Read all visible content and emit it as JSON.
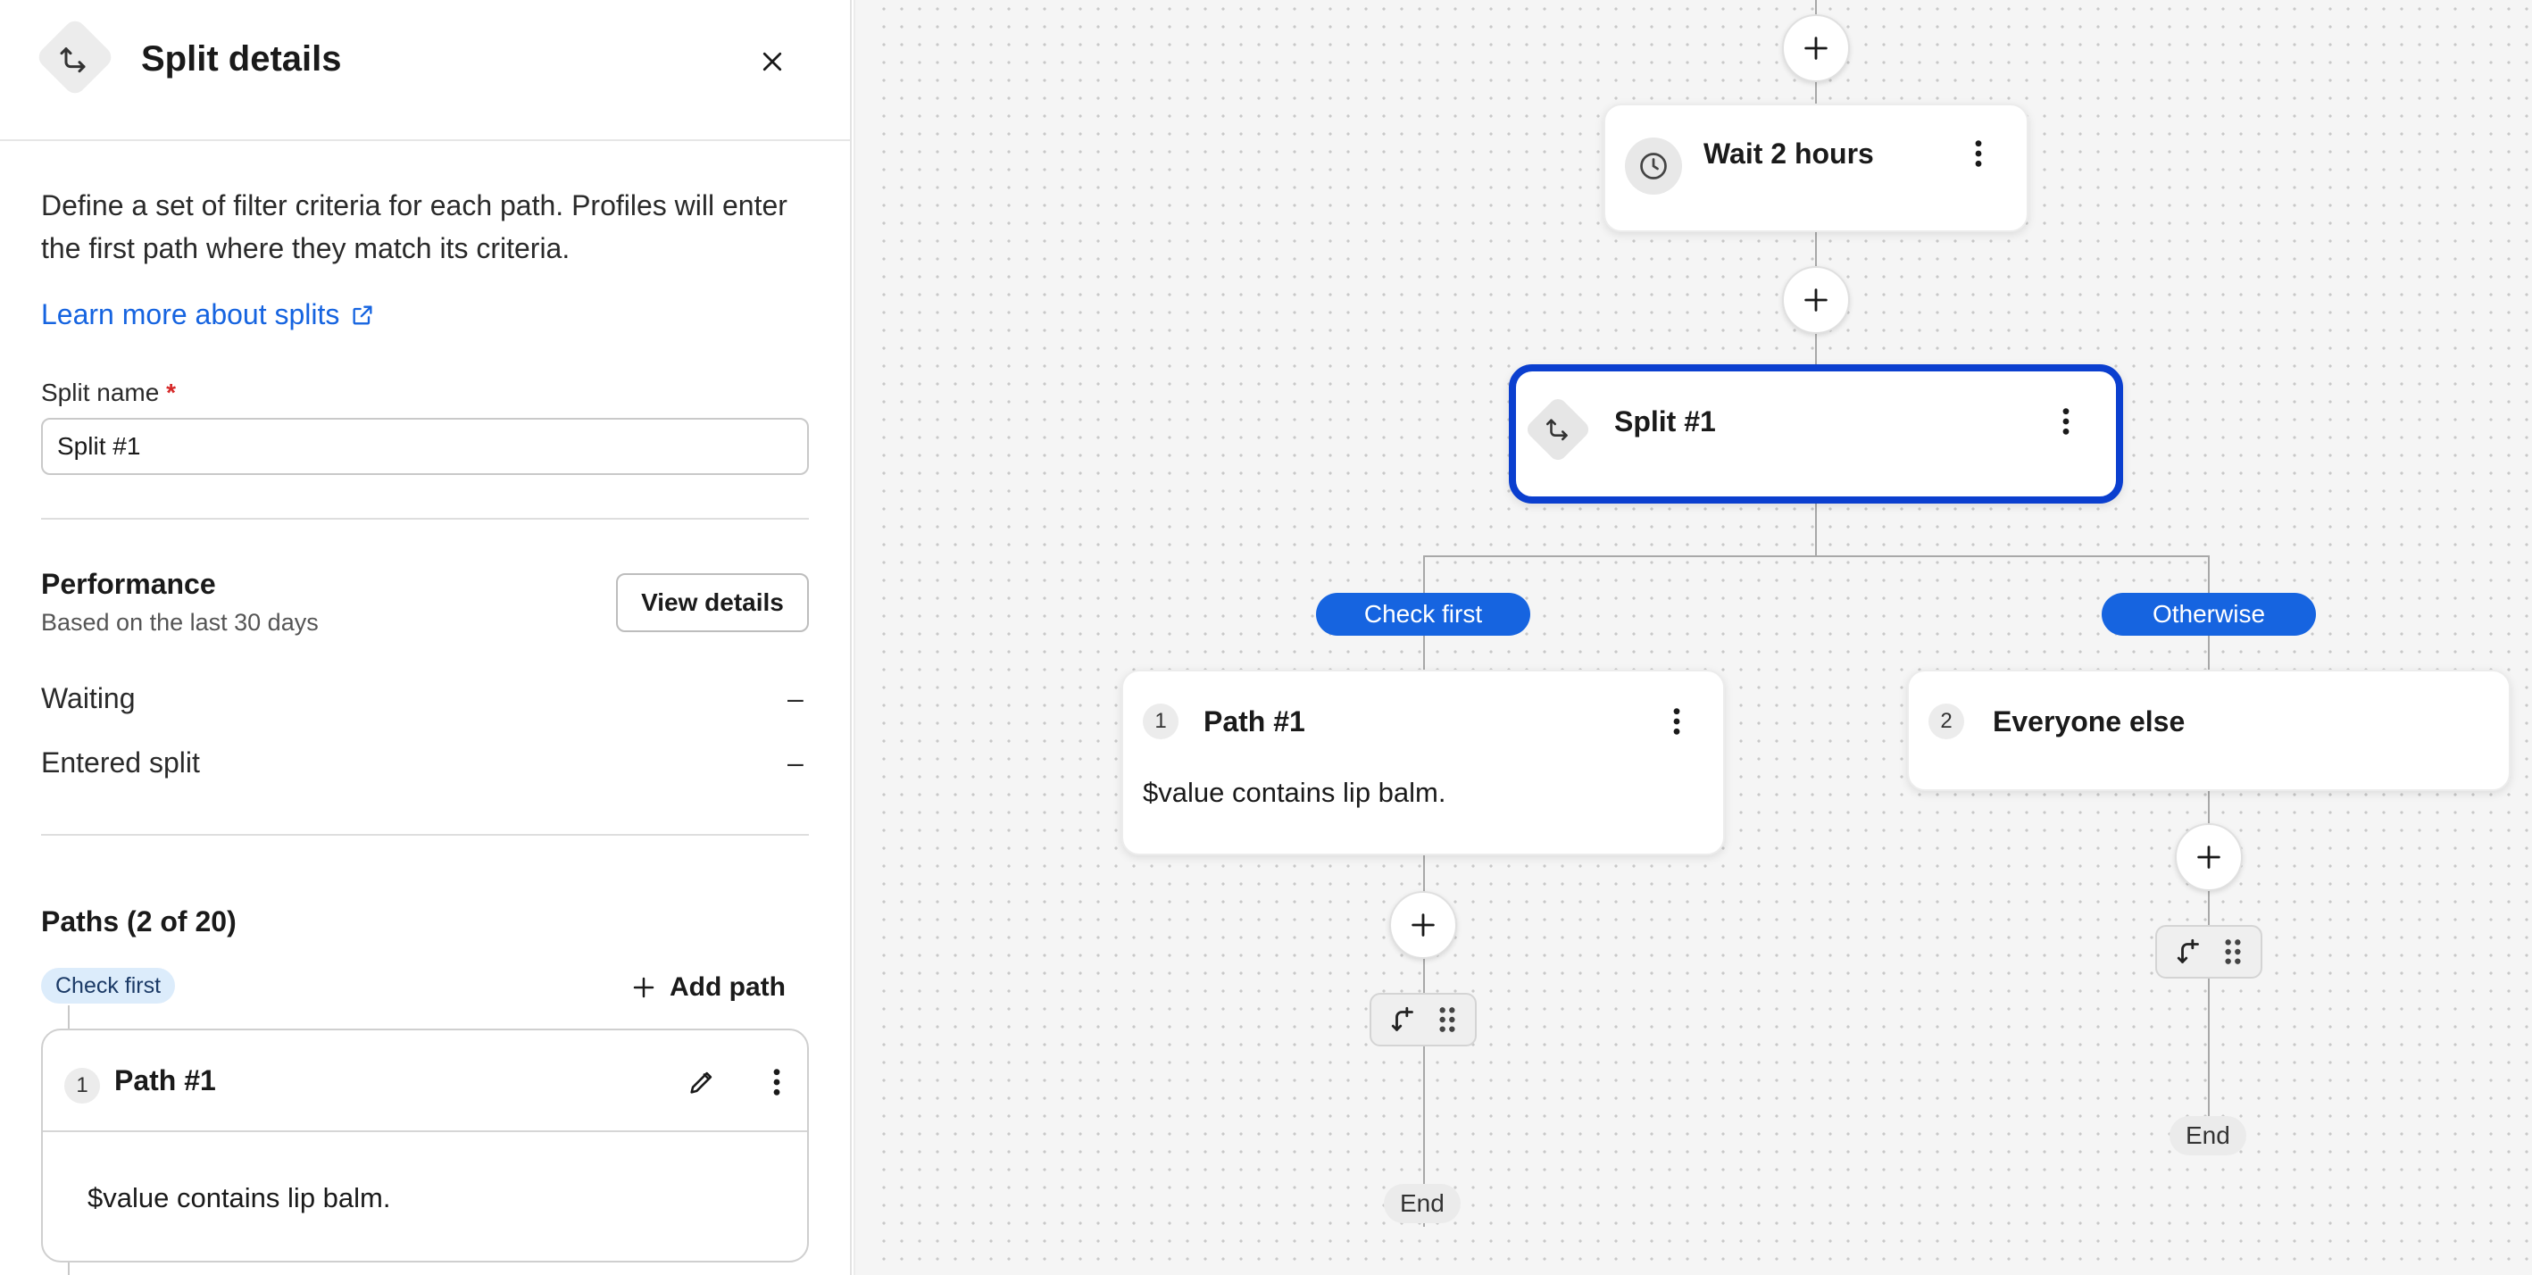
{
  "panel": {
    "title": "Split details",
    "description": "Define a set of filter criteria for each path. Profiles will enter the first path where they match its criteria.",
    "learn_more": "Learn more about splits",
    "split_name_label": "Split name",
    "required_mark": "*",
    "split_name_value": "Split #1",
    "performance": {
      "title": "Performance",
      "subtitle": "Based on the last 30 days",
      "view_details": "View details",
      "metrics": [
        {
          "label": "Waiting",
          "value": "–"
        },
        {
          "label": "Entered split",
          "value": "–"
        }
      ]
    },
    "paths": {
      "title": "Paths (2 of 20)",
      "check_first_badge": "Check first",
      "add_path": "Add path",
      "card": {
        "number": "1",
        "title": "Path #1",
        "condition": "$value contains lip balm."
      }
    }
  },
  "canvas": {
    "wait_node": {
      "title": "Wait 2 hours"
    },
    "split_node": {
      "title": "Split #1"
    },
    "branches": [
      {
        "pill": "Check first",
        "number": "1",
        "title": "Path #1",
        "condition": "$value contains lip balm.",
        "end": "End"
      },
      {
        "pill": "Otherwise",
        "number": "2",
        "title": "Everyone else",
        "end": "End"
      }
    ]
  },
  "colors": {
    "accent": "#1664e0",
    "selected_border": "#0b3fcf",
    "required": "#d62828"
  }
}
